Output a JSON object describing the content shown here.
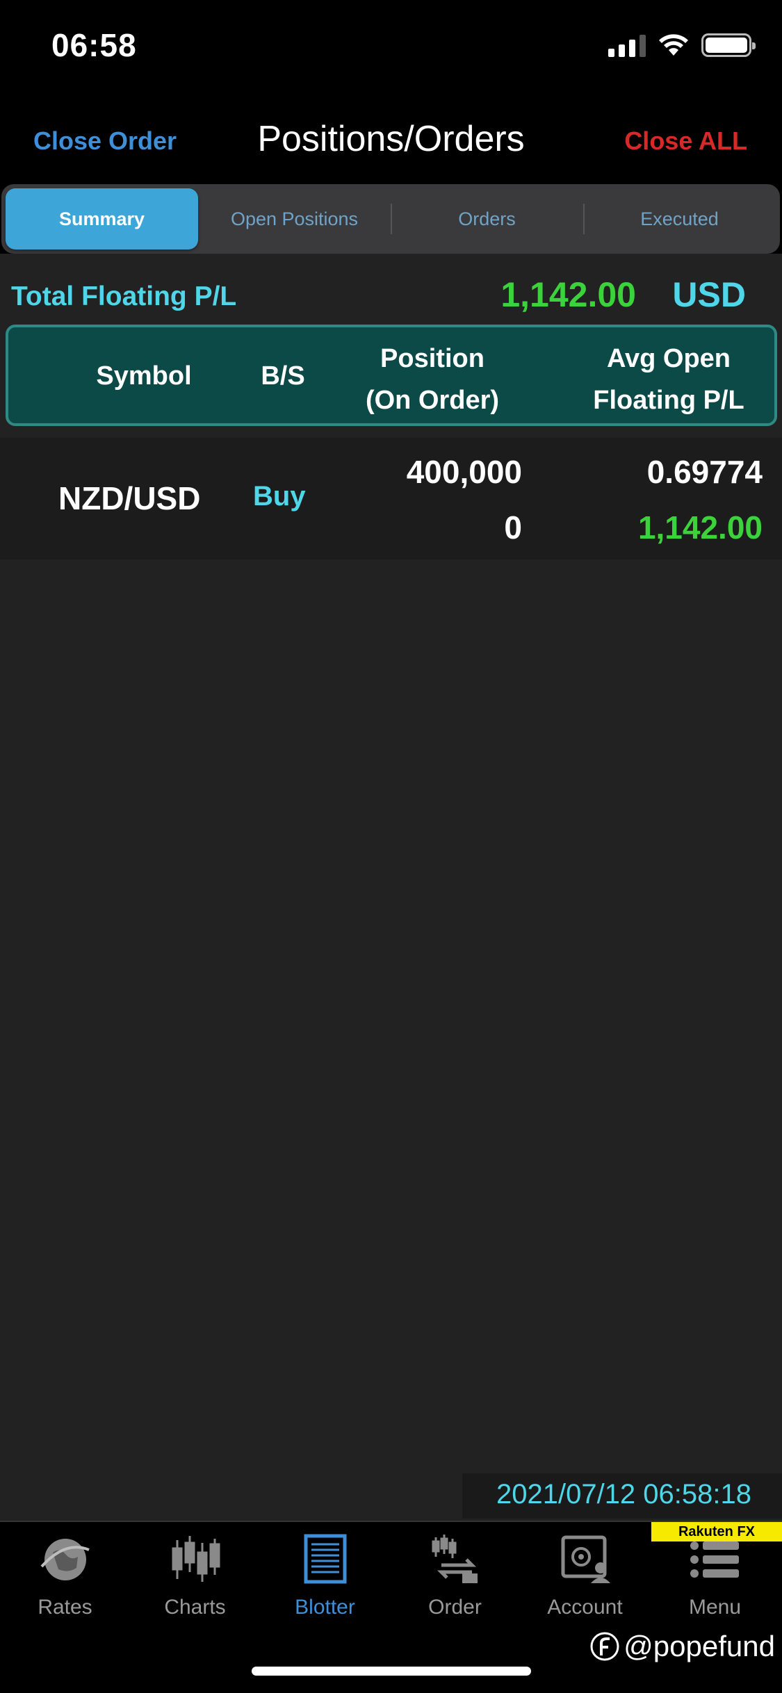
{
  "status": {
    "time": "06:58"
  },
  "header": {
    "close_order": "Close Order",
    "title": "Positions/Orders",
    "close_all": "Close ALL"
  },
  "tabs": [
    {
      "label": "Summary",
      "active": true
    },
    {
      "label": "Open Positions"
    },
    {
      "label": "Orders"
    },
    {
      "label": "Executed"
    }
  ],
  "totals": {
    "label": "Total Floating P/L",
    "value": "1,142.00",
    "currency": "USD"
  },
  "table": {
    "columns": {
      "symbol": "Symbol",
      "bs": "B/S",
      "position": "Position",
      "on_order": "(On Order)",
      "avg_open": "Avg Open",
      "floating_pl": "Floating P/L"
    },
    "rows": [
      {
        "symbol": "NZD/USD",
        "bs": "Buy",
        "position": "400,000",
        "on_order": "0",
        "avg_open": "0.69774",
        "floating_pl": "1,142.00"
      }
    ]
  },
  "timestamp": "2021/07/12 06:58:18",
  "brand_tag": "Rakuten FX",
  "nav": [
    {
      "label": "Rates",
      "icon": "globe-icon"
    },
    {
      "label": "Charts",
      "icon": "candlestick-icon"
    },
    {
      "label": "Blotter",
      "icon": "blotter-icon",
      "active": true
    },
    {
      "label": "Order",
      "icon": "order-icon"
    },
    {
      "label": "Account",
      "icon": "safe-icon"
    },
    {
      "label": "Menu",
      "icon": "list-menu-icon"
    }
  ],
  "watermark": "@popefund",
  "colors": {
    "accent_blue": "#3f8fd8",
    "cyan": "#4fd6e8",
    "profit_green": "#3bd23b",
    "danger_red": "#d82929",
    "header_teal": "#0c4a48"
  }
}
